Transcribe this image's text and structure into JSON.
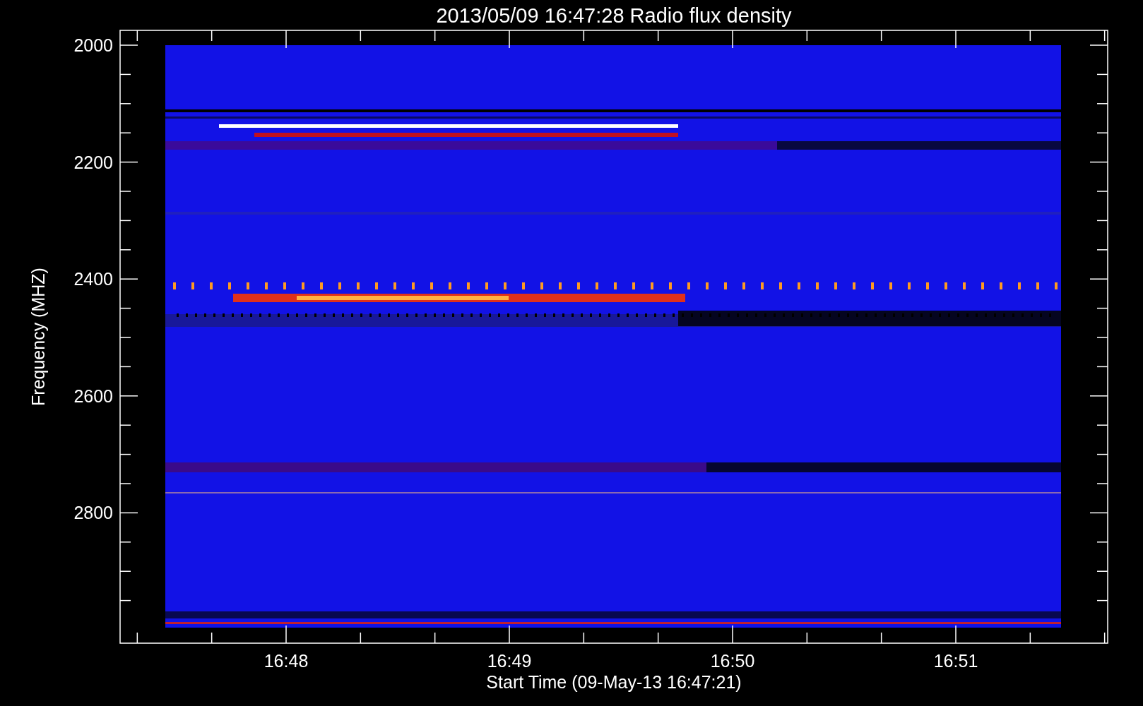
{
  "title": "2013/05/09 16:47:28 Radio flux density",
  "y_axis": {
    "label": "Frequency (MHZ)",
    "ticks": [
      "2000",
      "2200",
      "2400",
      "2600",
      "2800"
    ]
  },
  "x_axis": {
    "label": "Start Time (09-May-13 16:47:21)",
    "ticks": [
      "16:48",
      "16:49",
      "16:50",
      "16:51"
    ]
  }
}
